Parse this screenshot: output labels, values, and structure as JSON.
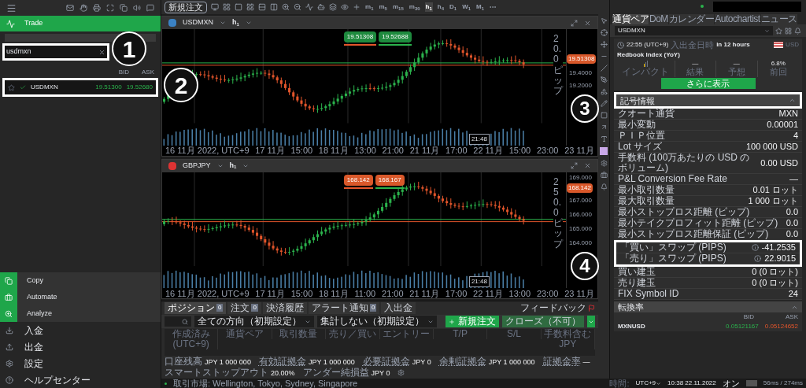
{
  "sidebar": {
    "section": "Trade",
    "search": {
      "value": "usdmxn"
    },
    "columns": [
      "BID",
      "ASK"
    ],
    "watchlist": [
      {
        "symbol": "USDMXN",
        "bid": "19.51300",
        "ask": "19.52680",
        "starred": false,
        "selected": true
      }
    ],
    "apps": [
      {
        "label": "Copy"
      },
      {
        "label": "Automate"
      },
      {
        "label": "Analyze"
      }
    ],
    "links": [
      {
        "label": "入金"
      },
      {
        "label": "出金"
      },
      {
        "label": "設定"
      },
      {
        "label": "ヘルプセンター"
      }
    ]
  },
  "toolbar": {
    "new_order": "新規注文",
    "timeframes": [
      {
        "unit": "m",
        "count": "1",
        "selected": false
      },
      {
        "unit": "m",
        "count": "5",
        "selected": false
      },
      {
        "unit": "m",
        "count": "15",
        "selected": false
      },
      {
        "unit": "m",
        "count": "30",
        "selected": false
      },
      {
        "unit": "h",
        "count": "1",
        "selected": true
      },
      {
        "unit": "h",
        "count": "4",
        "selected": false
      },
      {
        "unit": "D",
        "count": "1",
        "selected": false
      },
      {
        "unit": "W",
        "count": "1",
        "selected": false
      },
      {
        "unit": "M",
        "count": "1",
        "selected": false
      }
    ]
  },
  "charts": [
    {
      "symbol": "USDMXN",
      "timeframe": {
        "unit": "h",
        "count": "1"
      },
      "sell": "19.51308",
      "buy": "19.52688",
      "color": "#1e8a3e",
      "price_tag": "19.51308",
      "range_label": "20.0ピップ",
      "yticks": [
        "19.4000",
        "19.2000"
      ],
      "xticks": [
        "16 11月 2022, UTC+9",
        "17 11月",
        "15:00",
        "18 11月",
        "13:00",
        "21:00",
        "21 11月",
        "17:00",
        "22 11月",
        "15:00",
        "23:00",
        "23 11月"
      ],
      "cursor_time": "21:48"
    },
    {
      "symbol": "GBPJPY",
      "timeframe": {
        "unit": "h",
        "count": "1"
      },
      "sell": "168.142",
      "buy": "168.167",
      "color": "#d9582a",
      "price_tag": "168.142",
      "range_label": "250.0ピップ",
      "yticks": [
        "169.000",
        "167.000",
        "166.000",
        "165.000",
        "164.000"
      ],
      "xticks": [
        "16 11月 2022, UTC+9",
        "17 11月",
        "15:00",
        "18 11月",
        "11:00",
        "21:00",
        "21 11月",
        "17:00",
        "22 11月",
        "13:00",
        "23:00",
        "23 11月"
      ],
      "cursor_time": "21:48"
    }
  ],
  "positions": {
    "tabs": [
      {
        "label": "ポジション",
        "count": "0",
        "selected": true
      },
      {
        "label": "注文",
        "count": "0",
        "selected": false
      },
      {
        "label": "決済履歴",
        "selected": false
      },
      {
        "label": "アラート通知",
        "count": "0",
        "selected": false
      },
      {
        "label": "入出金",
        "selected": false
      }
    ],
    "feedback": "フィードバック",
    "filters": [
      "全ての方向（初期設定）",
      "集計しない（初期設定）"
    ],
    "new_order": "新規注文",
    "close": {
      "label": "クローズ（不可）",
      "disabled": true
    },
    "columns": [
      "作成済み (UTC+9)",
      "通貨ペア",
      "取引数量",
      "売り／買い",
      "エントリー",
      "T/P",
      "S/L",
      "手数料含む JPY"
    ],
    "summary": [
      {
        "label": "口座残高",
        "value": "JPY 1 000 000",
        "underlined": false
      },
      {
        "label": "有効証拠金",
        "value": "JPY 1 000 000",
        "underlined": true
      },
      {
        "label": "必要証拠金",
        "value": "JPY 0",
        "underlined": true
      },
      {
        "label": "余剰証拠金",
        "value": "JPY 1 000 000",
        "underlined": true
      },
      {
        "label": "証拠金率",
        "value": "—",
        "underlined": true
      },
      {
        "label": "スマートストップアウト",
        "value": "20.00%",
        "underlined": false
      },
      {
        "label": "アンダー純損益",
        "value": "JPY 0",
        "underlined": false
      }
    ]
  },
  "right_panel": {
    "tabs": [
      {
        "label": "通貨ペア",
        "selected": true
      },
      {
        "label": "DoM",
        "selected": false
      },
      {
        "label": "カレンダー",
        "selected": false
      },
      {
        "label": "Autochartist",
        "selected": false
      },
      {
        "label": "ニュース",
        "selected": false
      }
    ],
    "symbol": "USDMXN",
    "event": {
      "time": "22:55 (UTC+9)",
      "time_note": "入出金日時",
      "countdown": "in 12 hours",
      "currency": "USD",
      "title": "Redbook Index (YoY)",
      "impact_label": "インパクト",
      "stats": [
        {
          "value": "—",
          "label": "結果"
        },
        {
          "value": "—",
          "label": "予想"
        },
        {
          "value": "6.8%",
          "label": "前回"
        }
      ],
      "more": "さらに表示"
    },
    "symbol_info": {
      "title": "記号情報",
      "expanded": true,
      "rows": [
        {
          "label": "クオート通貨",
          "value": "MXN",
          "info": false
        },
        {
          "label": "最小変動",
          "value": "0.00001",
          "info": false
        },
        {
          "label": "ＰＩＰ位置",
          "value": "4",
          "info": false
        },
        {
          "label": "Lot サイズ",
          "value": "100 000 USD",
          "info": false
        },
        {
          "label": "手数料 (100万あたりの USD のボリューム)",
          "value": "0.00 USD",
          "info": false
        },
        {
          "label": "P&L Conversion Fee Rate",
          "value": "—",
          "info": false
        },
        {
          "label": "最小取引数量",
          "value": "0.01 ロット",
          "info": false
        },
        {
          "label": "最大取引数量",
          "value": "1 000 ロット",
          "info": false
        },
        {
          "label": "最小ストップロス距離 (ピップ)",
          "value": "0.0",
          "info": false
        },
        {
          "label": "最小テイクプロフィット距離 (ピップ)",
          "value": "0.0",
          "info": false
        },
        {
          "label": "最小ストップロス距離保証 (ピップ)",
          "value": "0.0",
          "info": false
        },
        {
          "label": "「買い」スワップ (PIPS)",
          "value": "-41.2535",
          "info": true
        },
        {
          "label": "「売り」スワップ (PIPS)",
          "value": "22.9015",
          "info": true
        },
        {
          "label": "買い建玉",
          "value": "0 (0 ロット)",
          "info": false
        },
        {
          "label": "売り建玉",
          "value": "0 (0 ロット)",
          "info": false
        },
        {
          "label": "FIX Symbol ID",
          "value": "24",
          "info": false
        }
      ]
    },
    "conversion": {
      "title": "転換率",
      "expanded": true,
      "columns": [
        "BID",
        "ASK"
      ],
      "rows": [
        {
          "pair": "MXNUSD",
          "bid": "0.05121167",
          "ask": "0.05124652"
        }
      ]
    }
  },
  "status": {
    "markets": "取引市場: Wellington, Tokyo, Sydney, Singapore",
    "time_label": "時間:",
    "timezone": "UTC+9",
    "datetime": "10:38 22.11.2022",
    "live_label": "オン",
    "live_on": false,
    "latency": "56ms / 274ms"
  },
  "annotations": [
    {
      "number": "1"
    },
    {
      "number": "2"
    },
    {
      "number": "3"
    },
    {
      "number": "4"
    }
  ]
}
